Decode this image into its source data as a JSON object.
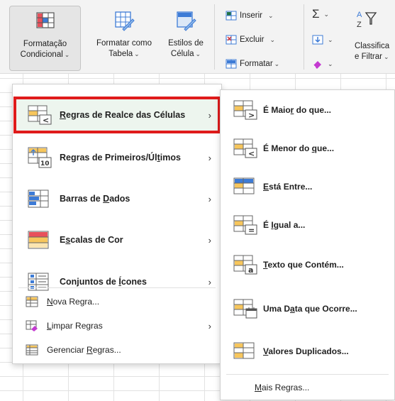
{
  "ribbon": {
    "conditional_formatting": {
      "line1": "Formatação",
      "line2": "Condicional"
    },
    "format_as_table": {
      "line1": "Formatar como",
      "line2": "Tabela"
    },
    "cell_styles": {
      "line1": "Estilos de",
      "line2": "Célula"
    },
    "insert": "Inserir",
    "delete": "Excluir",
    "format": "Formatar",
    "sort_filter": {
      "line1": "Classifica",
      "line2": "e Filtrar"
    },
    "caret": "⌄"
  },
  "main_menu": {
    "items": [
      {
        "pre": "",
        "key": "R",
        "post": "egras de Realce das Células",
        "arrow": "›"
      },
      {
        "pre": "Regras de Primeiros/Úl",
        "key": "t",
        "post": "imos",
        "arrow": "›"
      },
      {
        "pre": "Barras de ",
        "key": "D",
        "post": "ados",
        "arrow": "›"
      },
      {
        "pre": "E",
        "key": "s",
        "post": "calas de Cor",
        "arrow": "›"
      },
      {
        "pre": "Conjuntos de ",
        "key": "Í",
        "post": "cones",
        "arrow": "›"
      }
    ],
    "lower": [
      {
        "pre": "",
        "key": "N",
        "post": "ova Regra...",
        "arrow": ""
      },
      {
        "pre": "",
        "key": "L",
        "post": "impar Regras",
        "arrow": "›"
      },
      {
        "pre": "Gerenciar ",
        "key": "R",
        "post": "egras...",
        "arrow": ""
      }
    ]
  },
  "sub_menu": {
    "items": [
      {
        "pre": "É Maio",
        "key": "r",
        "post": " do que...",
        "glyph": ">"
      },
      {
        "pre": "É Menor do ",
        "key": "q",
        "post": "ue...",
        "glyph": "<"
      },
      {
        "pre": "",
        "key": "E",
        "post": "stá Entre...",
        "glyph": ""
      },
      {
        "pre": "É ",
        "key": "I",
        "post": "gual a...",
        "glyph": "="
      },
      {
        "pre": "",
        "key": "T",
        "post": "exto que Contém...",
        "glyph": "a"
      },
      {
        "pre": "Uma D",
        "key": "a",
        "post": "ta que Ocorre...",
        "glyph": ""
      },
      {
        "pre": "",
        "key": "V",
        "post": "alores Duplicados...",
        "glyph": ""
      }
    ],
    "more": {
      "pre": "",
      "key": "M",
      "post": "ais Regras..."
    }
  },
  "colors": {
    "highlight_border": "#e01b1b",
    "hover_bg": "#edf5ee",
    "cell_orange": "#f7c65c",
    "cell_blue": "#3d7bd6",
    "accent_green": "#217346"
  }
}
